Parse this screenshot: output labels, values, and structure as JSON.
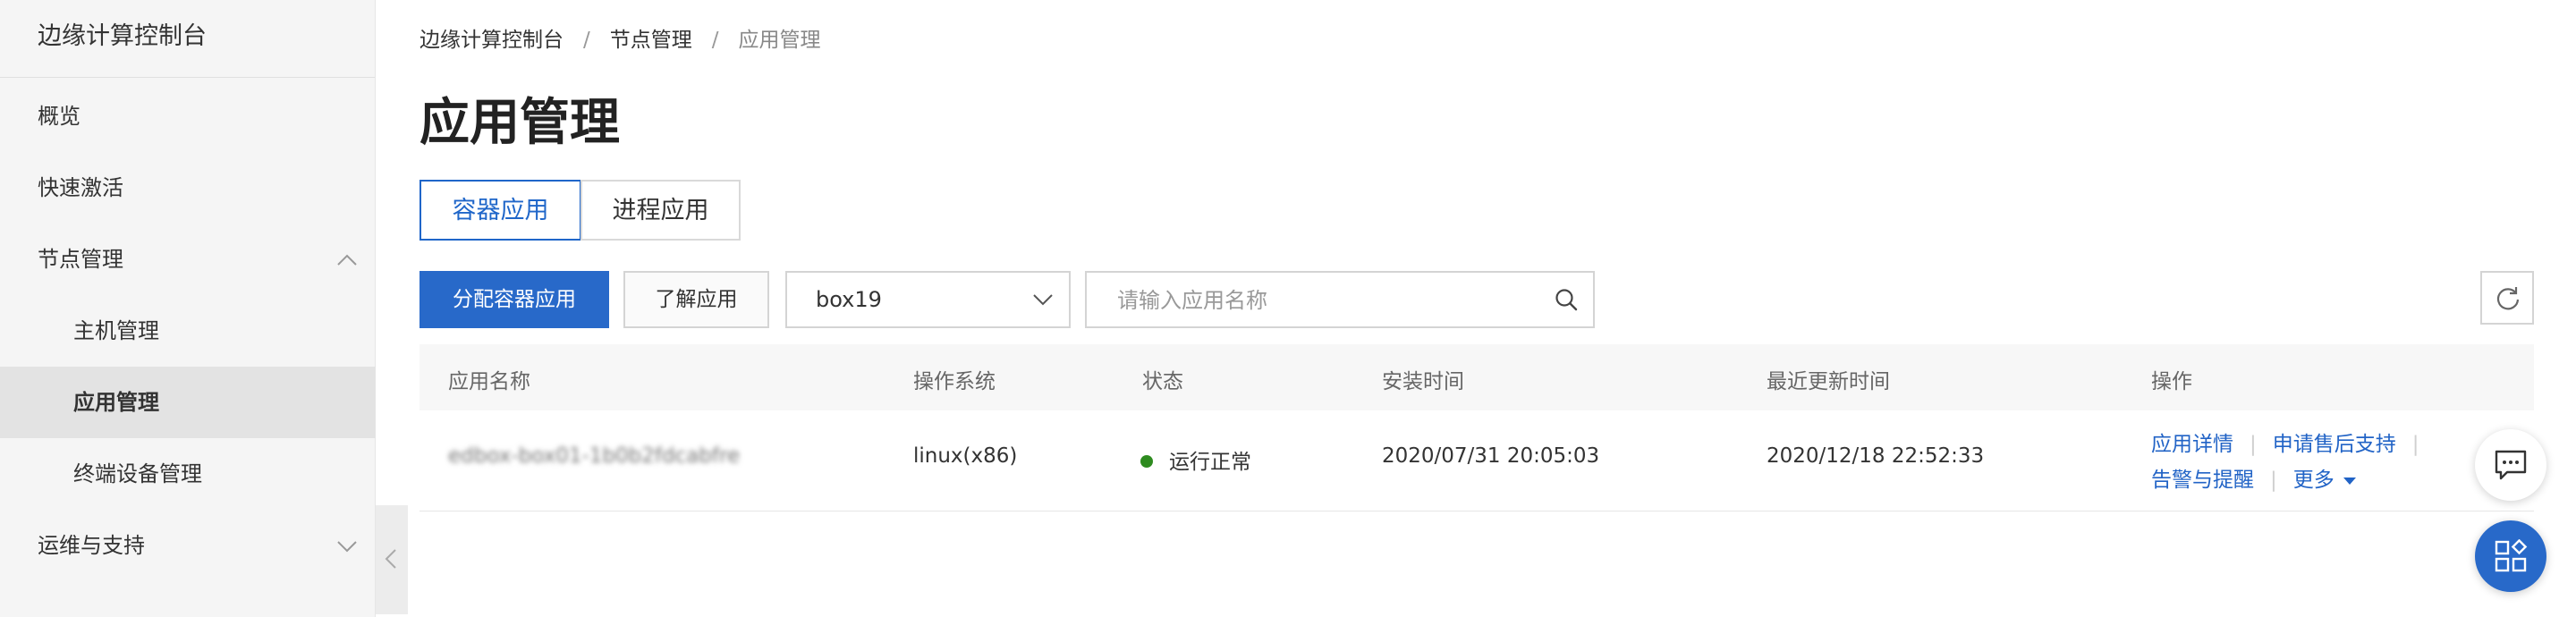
{
  "sidebar": {
    "title": "边缘计算控制台",
    "items": [
      {
        "label": "概览"
      },
      {
        "label": "快速激活"
      },
      {
        "label": "节点管理"
      },
      {
        "label": "主机管理"
      },
      {
        "label": "应用管理"
      },
      {
        "label": "终端设备管理"
      },
      {
        "label": "运维与支持"
      }
    ]
  },
  "breadcrumb": [
    "边缘计算控制台",
    "节点管理",
    "应用管理"
  ],
  "breadcrumb_sep": "/",
  "page_title": "应用管理",
  "tabs": [
    {
      "label": "容器应用"
    },
    {
      "label": "进程应用"
    }
  ],
  "toolbar": {
    "primary_label": "分配容器应用",
    "learn_label": "了解应用",
    "select_value": "box19",
    "search_placeholder": "请输入应用名称"
  },
  "table": {
    "headers": [
      "应用名称",
      "操作系统",
      "状态",
      "安装时间",
      "最近更新时间",
      "操作"
    ],
    "rows": [
      {
        "name": "edbox-box01-1b0b2fdcabfre",
        "os": "linux(x86)",
        "status": "运行正常",
        "install_time": "2020/07/31 20:05:03",
        "update_time": "2020/12/18 22:52:33",
        "actions": [
          "应用详情",
          "申请售后支持",
          "告警与提醒",
          "更多"
        ]
      }
    ]
  },
  "colors": {
    "primary": "#2869c9",
    "link": "#2163c6",
    "status_ok": "#2e8b1f",
    "sidebar_bg": "#f5f5f5"
  }
}
